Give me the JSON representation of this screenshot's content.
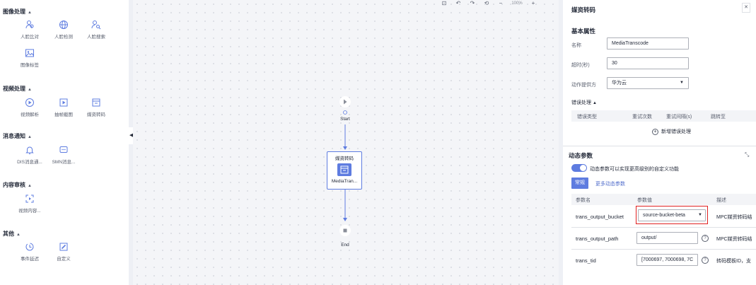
{
  "palette": {
    "sections": [
      {
        "title": "图像处理",
        "caret": "▲",
        "items": [
          "人脸比对",
          "人脸检测",
          "人脸搜索",
          "图像标签"
        ]
      },
      {
        "title": "视频处理",
        "caret": "▲",
        "items": [
          "视频解析",
          "抽帧截图",
          "媒资转码"
        ]
      },
      {
        "title": "消息通知",
        "caret": "▲",
        "items": [
          "DIS消息通...",
          "SMN消息..."
        ]
      },
      {
        "title": "内容审核",
        "caret": "▲",
        "items": [
          "视频内容..."
        ]
      },
      {
        "title": "其他",
        "caret": "▲",
        "items": [
          "事件延迟",
          "自定义"
        ]
      }
    ],
    "collapse_glyph": "◀"
  },
  "canvas": {
    "toolbar": {
      "save": "⊡",
      "undo": "↶",
      "redo": "↷",
      "fit": "⟲",
      "zoom_out": "−",
      "zoom": "100%",
      "zoom_in": "+"
    },
    "start_label": "Start",
    "end_label": "End",
    "task_node": {
      "title": "媒资转码",
      "name": "MediaTran..."
    }
  },
  "panel": {
    "header": "媒资转码",
    "basic_title": "基本属性",
    "name_label": "名称",
    "name_value": "MediaTranscode",
    "timeout_label": "超时(秒)",
    "timeout_value": "30",
    "provider_label": "动作提供方",
    "provider_value": "华为云",
    "error_title": "错误处理",
    "error_caret": "▲",
    "error_cols": [
      "错误类型",
      "重试次数",
      "重试间隔(s)",
      "跳转至"
    ],
    "add_error": "新增错误处理",
    "dyn_title": "动态参数",
    "dyn_toggle_text": "动态参数可以实现更高级别的自定义功能",
    "tab_normal": "常规",
    "tab_more": "更多动态参数",
    "param_cols": [
      "参数名",
      "参数值",
      "描述"
    ],
    "params": [
      {
        "name": "trans_output_bucket",
        "value": "source-bucket-beta",
        "desc": "MPC媒资转码结"
      },
      {
        "name": "trans_output_path",
        "value": "output/",
        "desc": "MPC媒资转码结"
      },
      {
        "name": "trans_tid",
        "value": "[7000697, 7000698, 7C",
        "desc": "转码模板ID，支"
      }
    ],
    "help_glyph": "?",
    "dropdown_glyph": "▼",
    "expand_glyph": "⤡"
  },
  "colors": {
    "accent": "#5e7ce0",
    "highlight": "#e02020",
    "canvas_bg": "#f4f5f8"
  }
}
